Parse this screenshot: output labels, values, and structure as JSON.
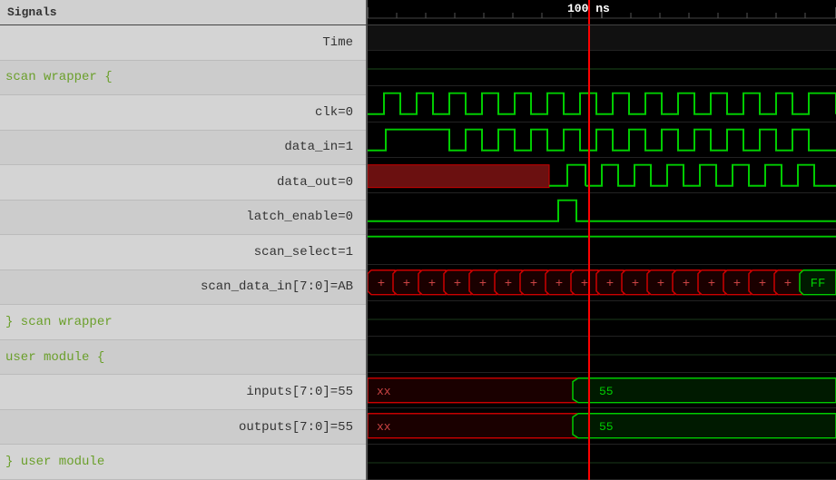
{
  "header": {
    "left_label": "Signals",
    "time_label": "100  ns"
  },
  "signals": [
    {
      "name": "Time",
      "type": "dark",
      "indent": 0
    },
    {
      "name": "scan wrapper {",
      "type": "green",
      "indent": 0
    },
    {
      "name": "clk=0",
      "type": "dark",
      "indent": 1
    },
    {
      "name": "data_in=1",
      "type": "dark",
      "indent": 1
    },
    {
      "name": "data_out=0",
      "type": "dark",
      "indent": 1
    },
    {
      "name": "latch_enable=0",
      "type": "dark",
      "indent": 1
    },
    {
      "name": "scan_select=1",
      "type": "dark",
      "indent": 1
    },
    {
      "name": "scan_data_in[7:0]=AB",
      "type": "dark",
      "indent": 1
    },
    {
      "name": "} scan wrapper",
      "type": "green",
      "indent": 0
    },
    {
      "name": "user module {",
      "type": "green",
      "indent": 0
    },
    {
      "name": "inputs[7:0]=55",
      "type": "dark",
      "indent": 1
    },
    {
      "name": "outputs[7:0]=55",
      "type": "dark",
      "indent": 1
    },
    {
      "name": "} user module",
      "type": "green",
      "indent": 0
    }
  ],
  "cursor_position_percent": 47,
  "waveforms": {
    "clk": "clock",
    "data_in": "pulse_high",
    "data_out": "dark_red_then_pulse",
    "latch_enable": "brief_pulse",
    "scan_select": "high_line",
    "scan_data_in": "bus_ab_ff",
    "blank1": "empty",
    "blank2": "empty",
    "inputs": "bus_xx_55",
    "outputs": "bus_xx_55"
  }
}
